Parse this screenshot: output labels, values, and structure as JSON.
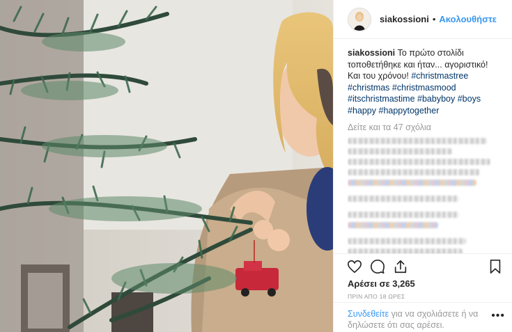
{
  "post": {
    "username": "siakossioni",
    "separator": "•",
    "follow_label": "Ακολουθήστε",
    "caption": {
      "username": "siakossioni",
      "text": "Το πρώτο στολίδι τοποθετήθηκε και ήταν... αγοριστικό! Και του χρόνου!",
      "hashtags": [
        "#christmastree",
        "#christmas",
        "#christmasmood",
        "#itschristmastime",
        "#babyboy",
        "#boys",
        "#happy",
        "#happytogether"
      ]
    },
    "view_all_comments": "Δείτε και τα 47 σχόλια",
    "likes_label": "Αρέσει σε 3,265",
    "time_label": "ΠΡΙΝ ΑΠΟ 18 ΩΡΕΣ",
    "login": {
      "link": "Συνδεθείτε",
      "text": "για να σχολιάσετε ή να δηλώσετε ότι σας αρέσει."
    },
    "more_label": "•••"
  },
  "icons": {
    "heart": "heart-icon",
    "comment": "comment-icon",
    "share": "share-icon",
    "save": "bookmark-icon"
  },
  "colors": {
    "link_blue": "#3897f0",
    "hashtag": "#003569",
    "muted": "#999999",
    "text": "#262626"
  }
}
